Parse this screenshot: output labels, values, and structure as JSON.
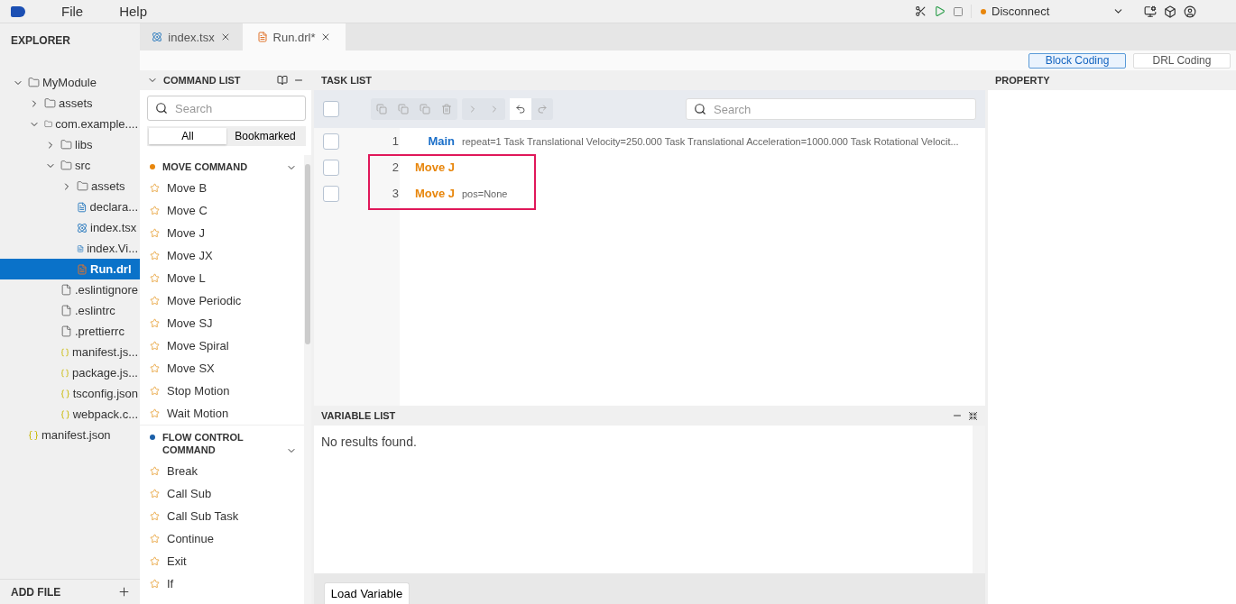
{
  "menu": [
    "File",
    "Help"
  ],
  "toolbar": {
    "connection": "Disconnect"
  },
  "explorer": {
    "title": "EXPLORER",
    "add_file": "ADD FILE",
    "tree": [
      {
        "label": "MyModule",
        "kind": "folder",
        "expanded": true,
        "selected": false,
        "children": [
          {
            "label": "assets",
            "kind": "folder",
            "expanded": false,
            "selected": false
          },
          {
            "label": "com.example....",
            "kind": "folder",
            "expanded": true,
            "selected": false,
            "children": [
              {
                "label": "libs",
                "kind": "folder",
                "expanded": false,
                "selected": false
              },
              {
                "label": "src",
                "kind": "folder",
                "expanded": true,
                "selected": false,
                "children": [
                  {
                    "label": "assets",
                    "kind": "folder",
                    "expanded": false,
                    "selected": false
                  },
                  {
                    "label": "declara...",
                    "kind": "ts",
                    "selected": false
                  },
                  {
                    "label": "index.tsx",
                    "kind": "react",
                    "selected": false
                  },
                  {
                    "label": "index.Vi...",
                    "kind": "ts",
                    "selected": false
                  },
                  {
                    "label": "Run.drl",
                    "kind": "drl",
                    "selected": true
                  }
                ]
              },
              {
                "label": ".eslintignore",
                "kind": "file",
                "selected": false
              },
              {
                "label": ".eslintrc",
                "kind": "file",
                "selected": false
              },
              {
                "label": ".prettierrc",
                "kind": "file",
                "selected": false
              },
              {
                "label": "manifest.js...",
                "kind": "json",
                "selected": false
              },
              {
                "label": "package.js...",
                "kind": "json",
                "selected": false
              },
              {
                "label": "tsconfig.json",
                "kind": "json",
                "selected": false
              },
              {
                "label": "webpack.c...",
                "kind": "js",
                "selected": false
              }
            ]
          }
        ]
      },
      {
        "label": "manifest.json",
        "kind": "json",
        "selected": false
      }
    ]
  },
  "tabs": [
    {
      "label": "index.tsx",
      "kind": "react",
      "selected": false
    },
    {
      "label": "Run.drl*",
      "kind": "drl",
      "selected": true
    }
  ],
  "modes": [
    {
      "label": "Block Coding",
      "selected": true
    },
    {
      "label": "DRL Coding",
      "selected": false
    }
  ],
  "command_list": {
    "title": "COMMAND LIST",
    "search_placeholder": "Search",
    "filters": [
      {
        "label": "All",
        "selected": true
      },
      {
        "label": "Bookmarked",
        "selected": false
      }
    ],
    "groups": [
      {
        "title": "MOVE COMMAND",
        "color": "#e8860c",
        "items": [
          "Move B",
          "Move C",
          "Move J",
          "Move JX",
          "Move L",
          "Move Periodic",
          "Move SJ",
          "Move Spiral",
          "Move SX",
          "Stop Motion",
          "Wait Motion"
        ]
      },
      {
        "title": "FLOW CONTROL COMMAND",
        "color": "#1b5fa8",
        "items": [
          "Break",
          "Call Sub",
          "Call Sub Task",
          "Continue",
          "Exit",
          "If"
        ]
      }
    ]
  },
  "task_list": {
    "title": "TASK LIST",
    "search_placeholder": "Search",
    "select_all_checked": false,
    "rows": [
      {
        "number": "1",
        "command": "Main",
        "kind": "main",
        "params": "repeat=1 Task Translational Velocity=250.000 Task Translational Acceleration=1000.000 Task Rotational Velocit...",
        "checked": false,
        "highlighted": false
      },
      {
        "number": "2",
        "command": "Move J",
        "kind": "move",
        "checked": false,
        "highlighted": true
      },
      {
        "number": "3",
        "command": "Move J",
        "kind": "move",
        "params": "pos=None",
        "checked": false,
        "highlighted": true
      }
    ]
  },
  "variable_list": {
    "title": "VARIABLE LIST",
    "empty_text": "No results found.",
    "button": "Load Variable"
  },
  "property": {
    "title": "PROPERTY"
  }
}
